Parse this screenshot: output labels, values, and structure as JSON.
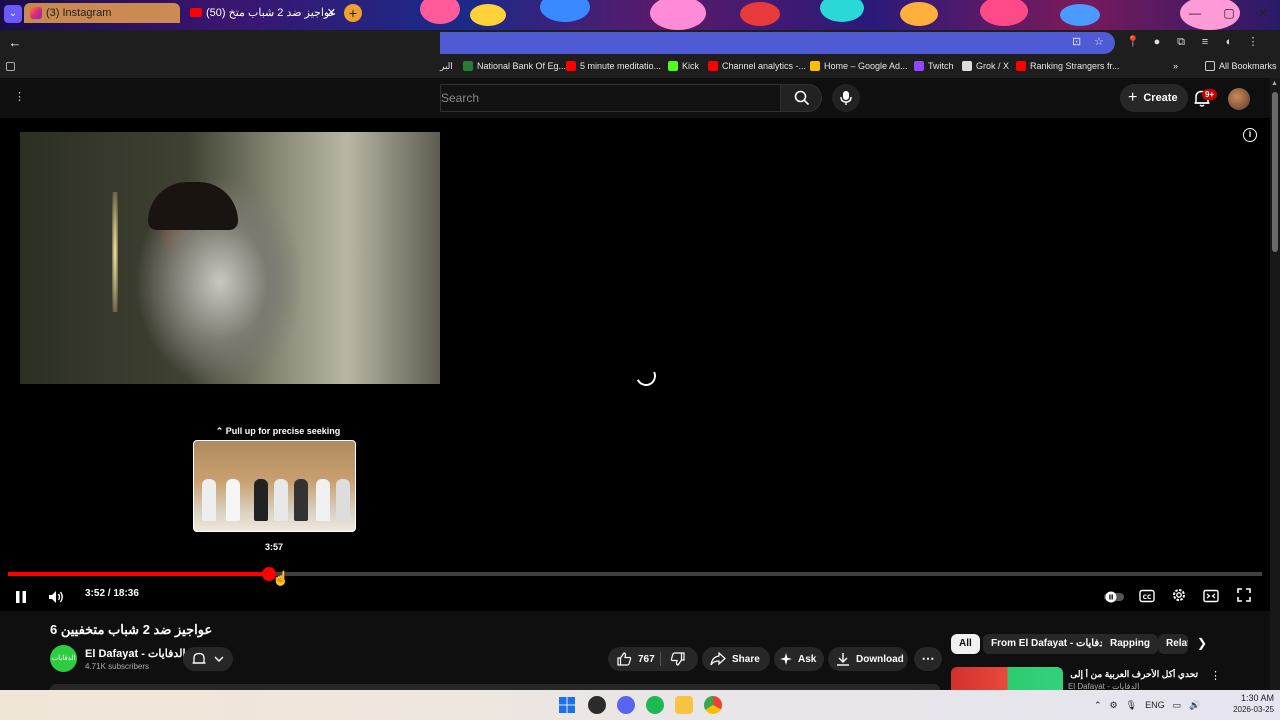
{
  "browser": {
    "tabs": [
      {
        "label": "(3) Instagram"
      },
      {
        "label": "(50) عواجيز ضد 2 شباب متخ",
        "close": "✕"
      }
    ],
    "new_tab": "+",
    "window_controls": [
      "—",
      "▢",
      "✕"
    ],
    "bookmarks": [
      {
        "label": "البر",
        "color": "#888888"
      },
      {
        "label": "National Bank Of Eg...",
        "color": "#2a7a3a"
      },
      {
        "label": "5 minute meditatio...",
        "color": "#ff0000"
      },
      {
        "label": "Kick",
        "color": "#53fc18"
      },
      {
        "label": "Channel analytics -...",
        "color": "#ff0000"
      },
      {
        "label": "Home – Google Ad...",
        "color": "#fbbc04"
      },
      {
        "label": "Twitch",
        "color": "#9146ff"
      },
      {
        "label": "Grok / X",
        "color": "#dddddd"
      },
      {
        "label": "Ranking Strangers fr...",
        "color": "#ff0000"
      }
    ],
    "bookmarks_overflow": "»",
    "all_bookmarks": "All Bookmarks"
  },
  "youtube": {
    "search": {
      "placeholder": "Search"
    },
    "create_label": "Create",
    "notification_badge": "9+",
    "player": {
      "seek_hint": "⌃ Pull up for precise seeking",
      "seek_preview_time": "3:57",
      "time_display": "3:52 / 18:36",
      "progress_fraction": 0.2079
    },
    "video": {
      "title": "عواجيز ضد 2 شباب متخفيين 6",
      "channel_name": "El Dafayat - الدفايات",
      "channel_avatar_text": "الدفايات",
      "subscribers": "4.71K subscribers",
      "likes": "767",
      "share_label": "Share",
      "ask_label": "Ask",
      "download_label": "Download"
    },
    "chips": [
      "All",
      "From El Dafayat - الدفايات",
      "Rapping",
      "Related"
    ],
    "recommendation": {
      "title": "تحدي أكل الأحرف العربية من أ إلى ي",
      "channel": "El Dafayat - الدفايات"
    }
  },
  "taskbar": {
    "tray_lang": "ENG",
    "time": "1:30 AM",
    "date": "2026-03-25"
  },
  "colors": {
    "youtube_red": "#ff0000",
    "omnibox": "#4f5bd5",
    "background": "#0f0f0f"
  }
}
